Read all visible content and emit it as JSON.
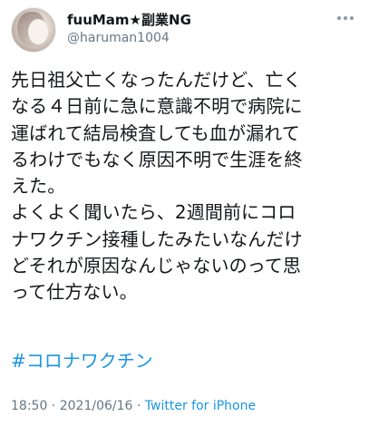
{
  "author": {
    "display_name": "fuuMam★副業NG",
    "username": "@haruman1004"
  },
  "tweet": {
    "lines": [
      "先日祖父亡くなったんだけど、亡く",
      "なる４日前に急に意識不明で病院に",
      "運ばれて結局検査しても血が漏れて",
      "るわけでもなく原因不明で生涯を終",
      "えた。",
      "よくよく聞いたら、2週間前にコロ",
      "ナワクチン接種したみたいなんだけ",
      "どそれが原因なんじゃないのって思",
      "って仕方ない。"
    ],
    "hashtag": "#コロナワクチン"
  },
  "meta": {
    "time": "18:50",
    "sep1": " · ",
    "date": "2021/06/16",
    "sep2": " · ",
    "source": "Twitter for iPhone"
  },
  "colors": {
    "link": "#1b95e0",
    "secondary": "#657786",
    "text": "#14171a"
  },
  "icons": {
    "more": "more-dots-icon"
  }
}
